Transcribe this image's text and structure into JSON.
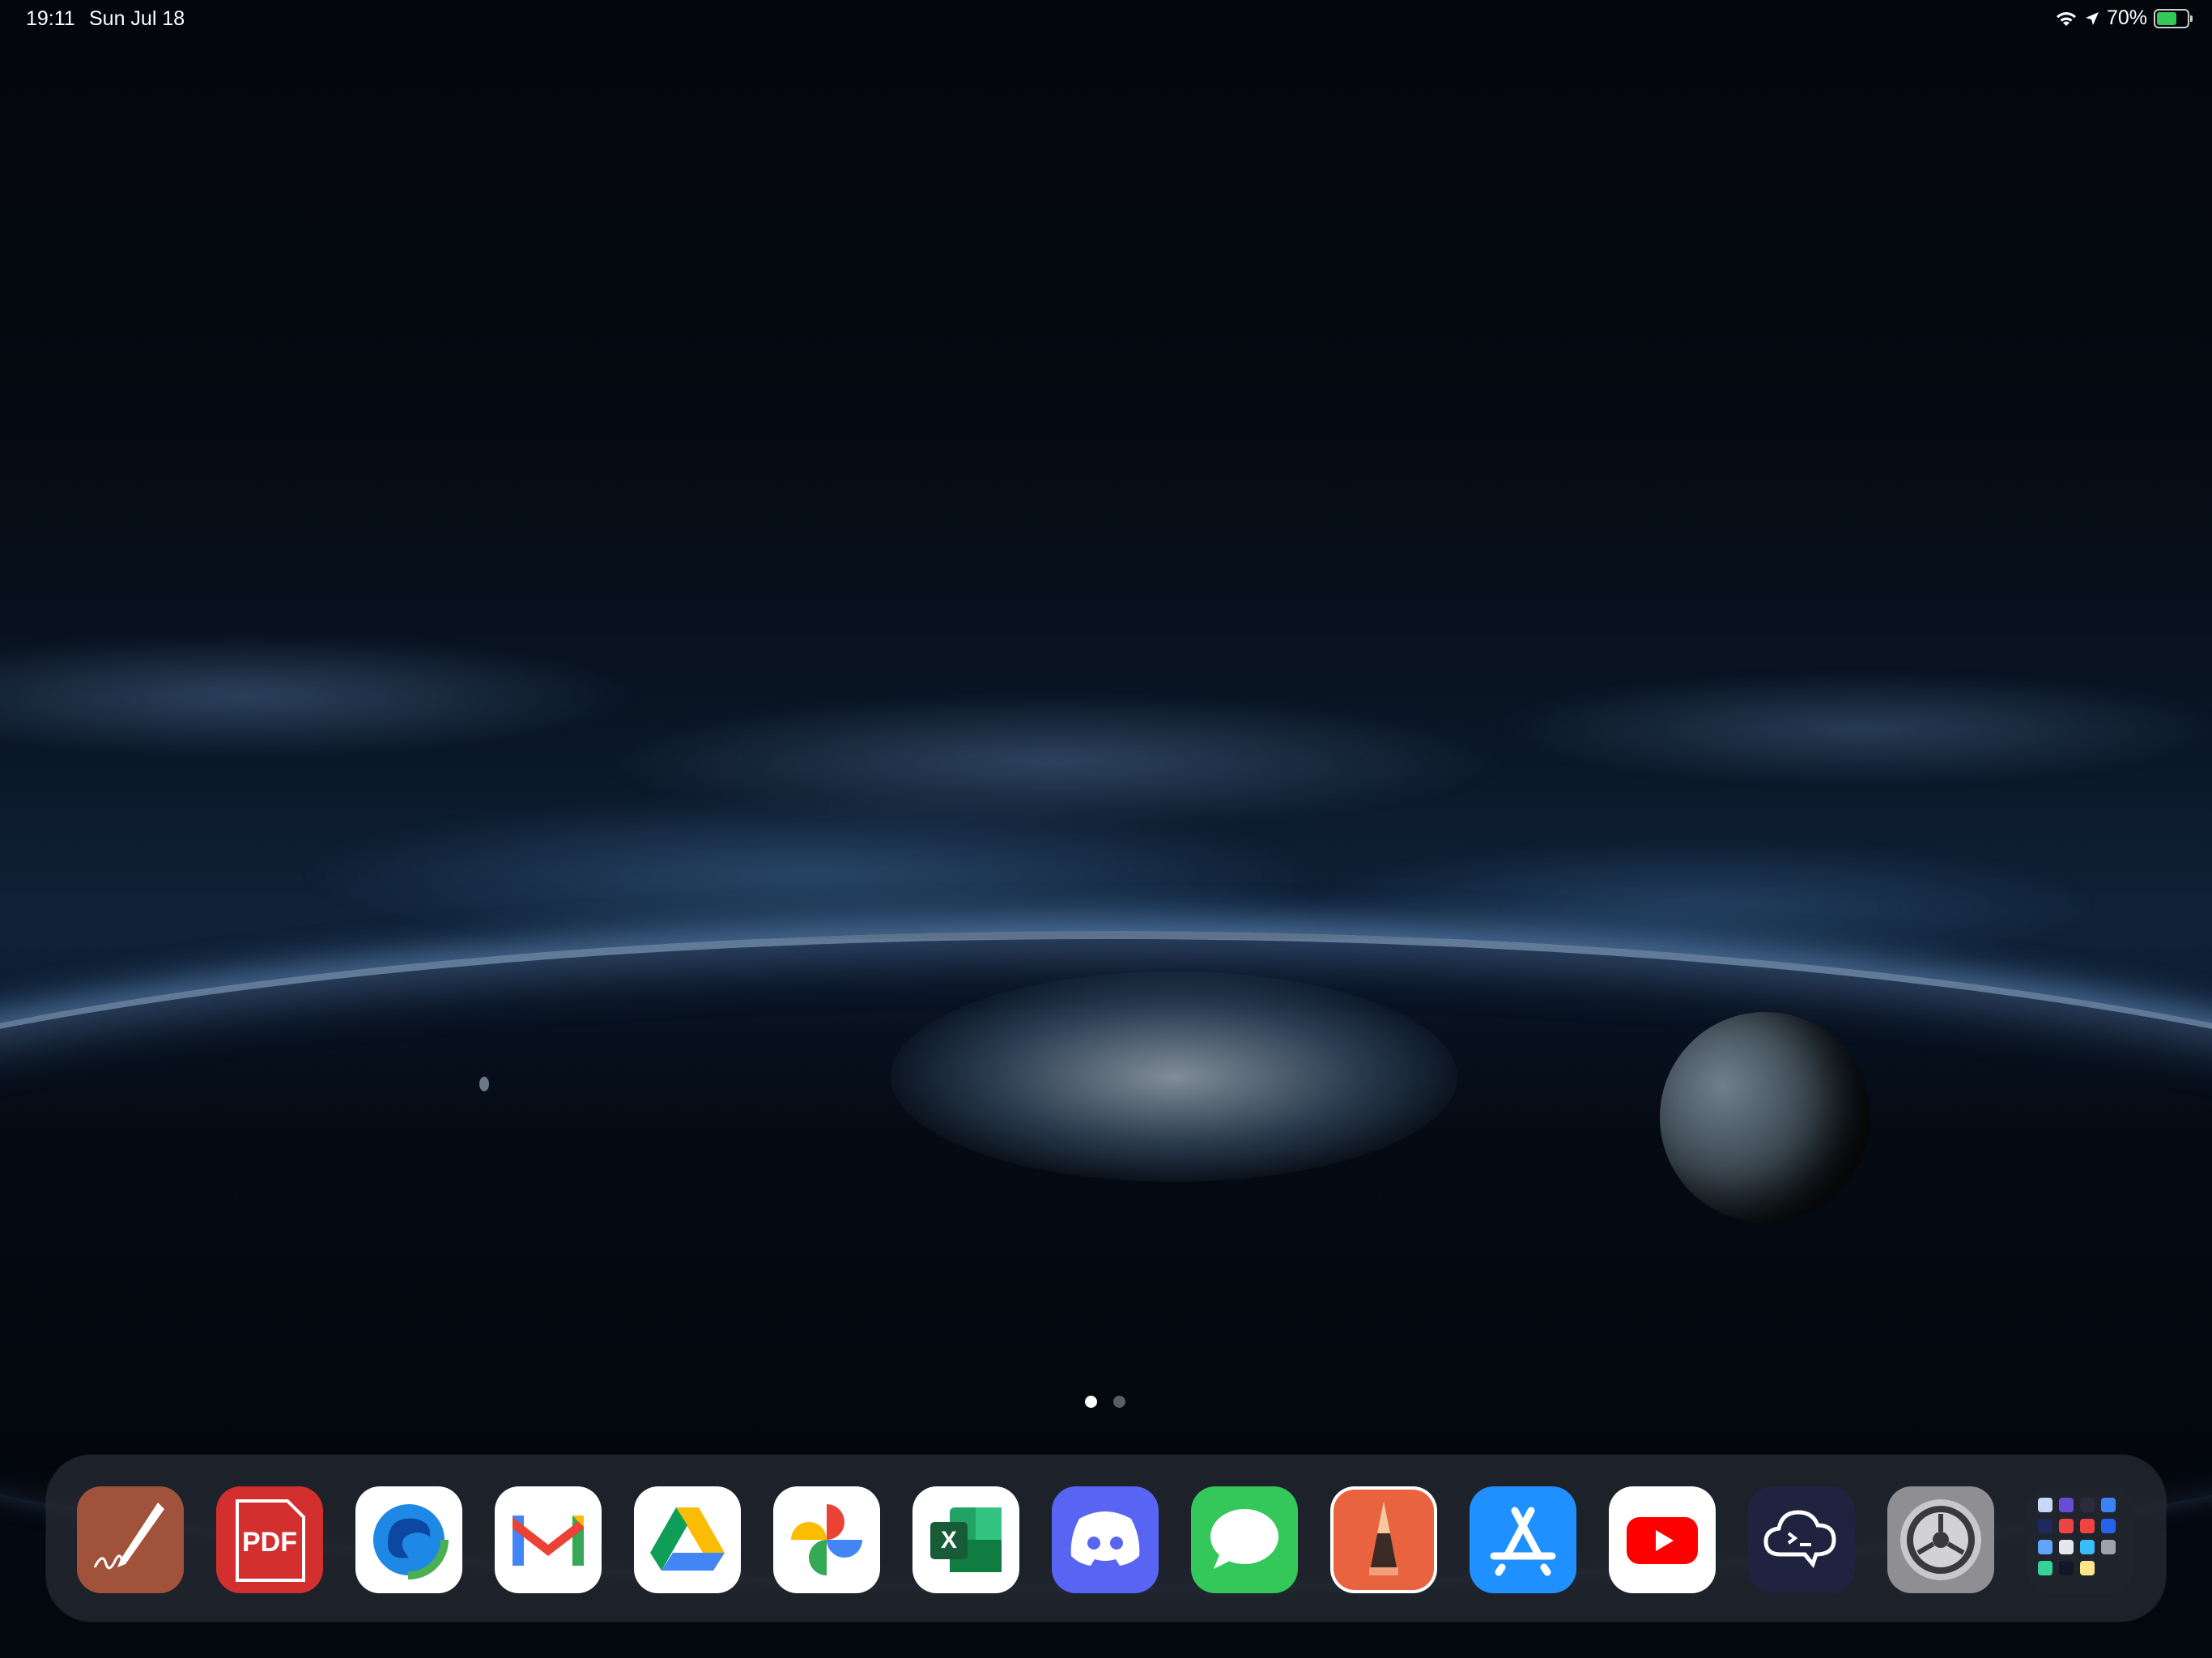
{
  "status_bar": {
    "time": "19:11",
    "date": "Sun Jul 18",
    "battery_percent": "70%",
    "battery_level": 0.7,
    "charging": true,
    "icons": [
      "wifi-icon",
      "location-arrow-icon",
      "battery-charging-icon"
    ]
  },
  "home": {
    "page_count": 2,
    "current_page": 1
  },
  "dock": {
    "apps": [
      {
        "name": "Notes Writer",
        "icon": "pen-signature-icon"
      },
      {
        "name": "PDF Expert",
        "icon": "pdf-icon"
      },
      {
        "name": "Microsoft Edge",
        "icon": "edge-icon"
      },
      {
        "name": "Gmail",
        "icon": "gmail-icon"
      },
      {
        "name": "Google Drive",
        "icon": "google-drive-icon"
      },
      {
        "name": "Google Photos",
        "icon": "google-photos-icon"
      },
      {
        "name": "Microsoft Excel",
        "icon": "excel-icon"
      },
      {
        "name": "Discord",
        "icon": "discord-icon"
      },
      {
        "name": "Messages",
        "icon": "messages-icon"
      },
      {
        "name": "Sketchbook",
        "icon": "pencil-icon"
      },
      {
        "name": "App Store",
        "icon": "app-store-icon"
      },
      {
        "name": "YouTube",
        "icon": "youtube-icon"
      },
      {
        "name": "Terminus",
        "icon": "terminal-cloud-icon"
      },
      {
        "name": "Settings",
        "icon": "gear-icon"
      },
      {
        "name": "App Library",
        "icon": "app-library-icon"
      }
    ],
    "pdf_label": "PDF",
    "excel_label": "X"
  }
}
